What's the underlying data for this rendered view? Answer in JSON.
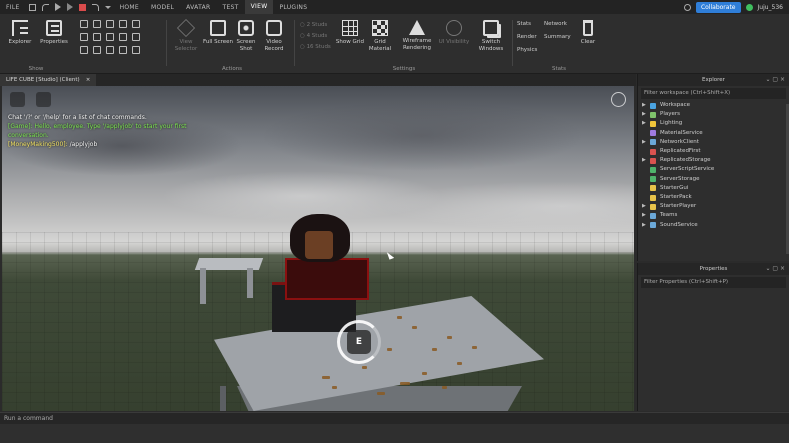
{
  "menubar": {
    "file": "FILE",
    "tabs": [
      "HOME",
      "MODEL",
      "AVATAR",
      "TEST",
      "VIEW",
      "PLUGINS"
    ],
    "active_tab": "VIEW",
    "collaborate": "Collaborate",
    "user": "Juju_536"
  },
  "ribbon": {
    "show_group": {
      "label": "Show",
      "explorer": "Explorer",
      "properties": "Properties"
    },
    "actions_group": {
      "label": "Actions",
      "view_selector": "View Selector",
      "full_screen": "Full Screen",
      "screen_shot": "Screen Shot",
      "video_record": "Video Record"
    },
    "settings_group": {
      "label": "Settings",
      "studs": [
        "2 Studs",
        "4 Studs",
        "16 Studs"
      ],
      "show_grid": "Show Grid",
      "grid_material": "Grid Material",
      "wireframe": "Wireframe Rendering",
      "ui_visibility": "UI Visibility",
      "switch_windows": "Switch Windows"
    },
    "stats_group": {
      "label": "Stats",
      "stats": "Stats",
      "network": "Network",
      "render": "Render",
      "summary": "Summary",
      "physics": "Physics",
      "clear": "Clear"
    }
  },
  "viewport_tab": {
    "title": "LIFE CUBE [Studio] (Client)",
    "close": "×"
  },
  "chat": {
    "line1": "Chat '/?' or '/help' for a list of chat commands.",
    "line2": "[Game]: Hello, employee. Type '/applyjob' to start your first",
    "line3": "conversation.",
    "speaker": "[MoneyMaking500]:",
    "message": "/applyjob"
  },
  "prompt": {
    "key": "E"
  },
  "command_bar": {
    "placeholder": "Run a command"
  },
  "explorer": {
    "title": "Explorer",
    "filter": "Filter workspace (Ctrl+Shift+X)",
    "items": [
      {
        "label": "Workspace",
        "color": "#4aa3e0",
        "arrow": "▶"
      },
      {
        "label": "Players",
        "color": "#7fc36b",
        "arrow": "▶"
      },
      {
        "label": "Lighting",
        "color": "#f0c53a",
        "arrow": "▶"
      },
      {
        "label": "MaterialService",
        "color": "#9f7be0",
        "arrow": ""
      },
      {
        "label": "NetworkClient",
        "color": "#6ba8d8",
        "arrow": "▶"
      },
      {
        "label": "ReplicatedFirst",
        "color": "#d9534f",
        "arrow": ""
      },
      {
        "label": "ReplicatedStorage",
        "color": "#d9534f",
        "arrow": "▶"
      },
      {
        "label": "ServerScriptService",
        "color": "#4fb36b",
        "arrow": ""
      },
      {
        "label": "ServerStorage",
        "color": "#4fb36b",
        "arrow": ""
      },
      {
        "label": "StarterGui",
        "color": "#e8c34a",
        "arrow": ""
      },
      {
        "label": "StarterPack",
        "color": "#e8c34a",
        "arrow": ""
      },
      {
        "label": "StarterPlayer",
        "color": "#e8c34a",
        "arrow": "▶"
      },
      {
        "label": "Teams",
        "color": "#6ba8d8",
        "arrow": "▶"
      },
      {
        "label": "SoundService",
        "color": "#6ba8d8",
        "arrow": "▶"
      }
    ]
  },
  "properties": {
    "title": "Properties",
    "filter": "Filter Properties (Ctrl+Shift+P)"
  }
}
